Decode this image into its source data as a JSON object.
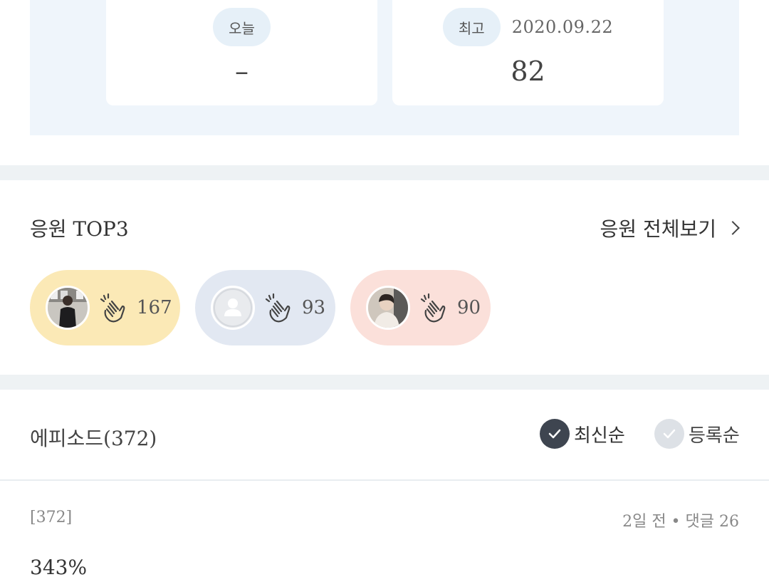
{
  "stats": {
    "today": {
      "label": "오늘",
      "value": "–"
    },
    "best": {
      "label": "최고",
      "date": "2020.09.22",
      "value": "82"
    }
  },
  "cheer": {
    "title": "응원 TOP3",
    "view_all": "응원 전체보기",
    "supporters": [
      {
        "count": "167",
        "avatar": "photo-avatar",
        "color": "#fbe9b6"
      },
      {
        "count": "93",
        "avatar": "default-avatar",
        "color": "#e2e8f2"
      },
      {
        "count": "90",
        "avatar": "photo-avatar",
        "color": "#fbe0da"
      }
    ]
  },
  "episodes": {
    "title": "에피소드(372)",
    "sort_latest": "최신순",
    "sort_registered": "등록순",
    "items": [
      {
        "number": "[372]",
        "meta": "2일 전 • 댓글 26",
        "title": "343%"
      }
    ]
  },
  "colors": {
    "panel_bg": "#eff5fb",
    "accent_dark": "#3e4550",
    "gold": "#fbe9b6",
    "blue": "#e2e8f2",
    "pink": "#fbe0da"
  }
}
